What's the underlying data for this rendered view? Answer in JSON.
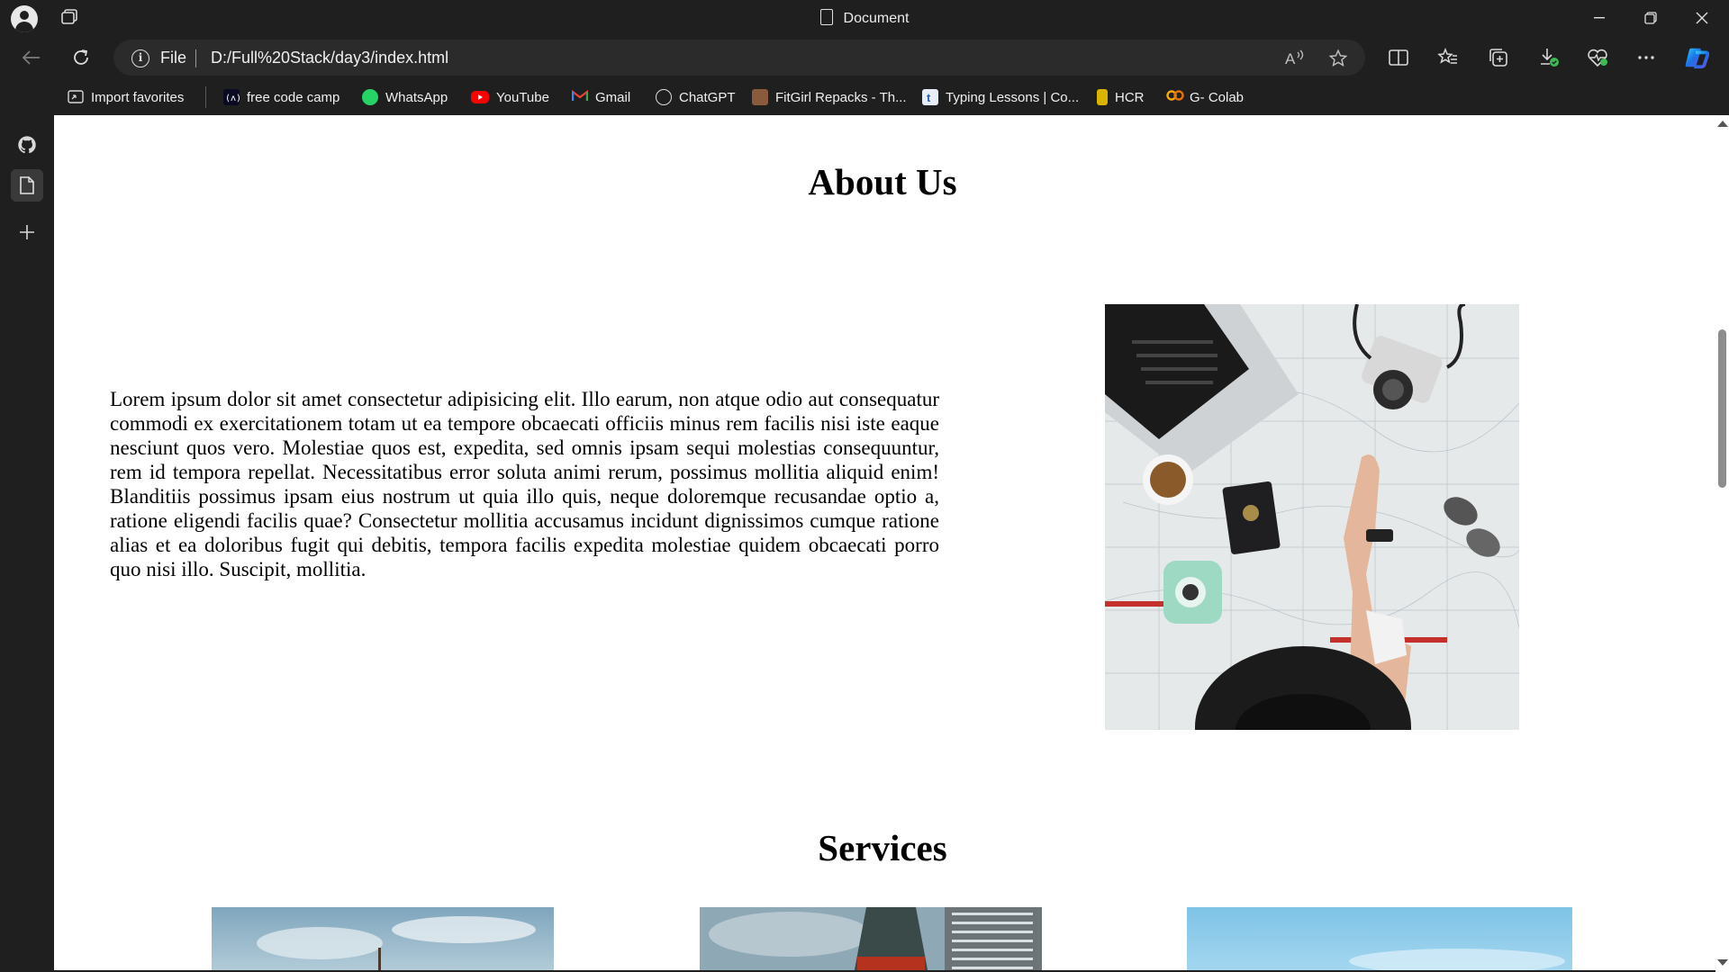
{
  "window": {
    "title": "Document"
  },
  "address_bar": {
    "scheme_label": "File",
    "url": "D:/Full%20Stack/day3/index.html"
  },
  "favorites": [
    {
      "label": "Import favorites",
      "icon": "import-favorites-icon"
    },
    {
      "label": "free code camp",
      "icon": "freecodecamp-icon"
    },
    {
      "label": "WhatsApp",
      "icon": "whatsapp-icon"
    },
    {
      "label": "YouTube",
      "icon": "youtube-icon"
    },
    {
      "label": "Gmail",
      "icon": "gmail-icon"
    },
    {
      "label": "ChatGPT",
      "icon": "chatgpt-icon"
    },
    {
      "label": "FitGirl Repacks - Th...",
      "icon": "fitgirl-icon"
    },
    {
      "label": "Typing Lessons | Co...",
      "icon": "typing-icon"
    },
    {
      "label": "HCR",
      "icon": "hcr-icon"
    },
    {
      "label": "G- Colab",
      "icon": "colab-icon"
    }
  ],
  "page": {
    "about_heading": "About Us",
    "about_text": "Lorem ipsum dolor sit amet consectetur adipisicing elit. Illo earum, non atque odio aut consequatur commodi ex exercitationem totam ut ea tempore obcaecati officiis minus rem facilis nisi iste eaque nesciunt quos vero. Molestiae quos est, expedita, sed omnis ipsam sequi molestias consequuntur, rem id tempora repellat. Necessitatibus error soluta animi rerum, possimus mollitia aliquid enim! Blanditiis possimus ipsam eius nostrum ut quia illo quis, neque doloremque recusandae optio a, ratione eligendi facilis quae? Consectetur mollitia accusamus incidunt dignissimos cumque ratione alias et ea doloribus fugit qui debitis, tempora facilis expedita molestiae quidem obcaecati porro quo nisi illo. Suscipit, mollitia.",
    "services_heading": "Services"
  },
  "colors": {
    "chrome_bg": "#1f1f1f",
    "address_bg": "#2b2b2b",
    "page_bg": "#ffffff",
    "whatsapp_green": "#25d366",
    "youtube_red": "#ff0000"
  }
}
